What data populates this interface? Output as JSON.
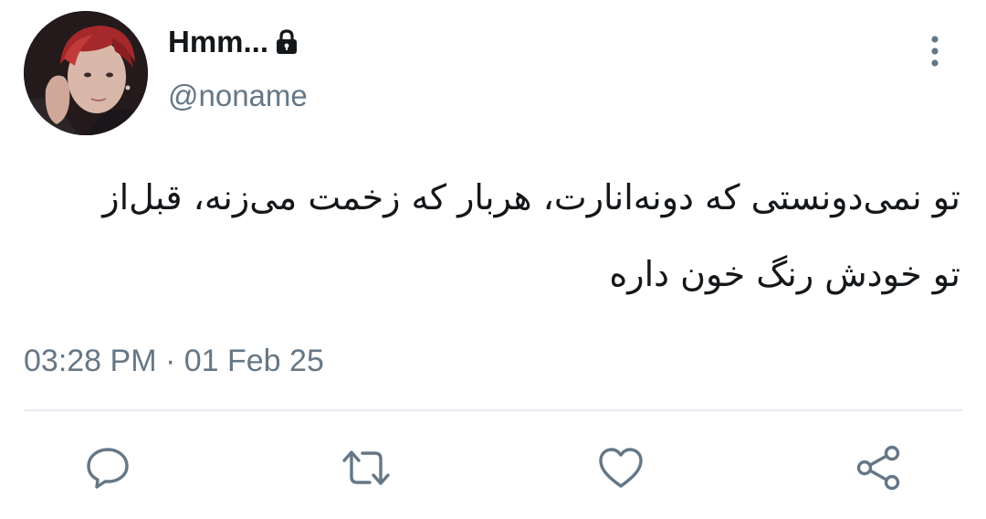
{
  "user": {
    "display_name": "Hmm...",
    "handle": "@noname",
    "protected_icon": "lock-icon",
    "avatar_icon": "profile-avatar"
  },
  "tweet": {
    "lines": [
      "تو نمی‌دونستی که دونه‌انارت، هربار که زخمت می‌زنه، قبل‌از",
      "تو خودش رنگ خون داره"
    ],
    "timestamp": "03:28 PM · 01 Feb 25"
  },
  "actions": {
    "reply_icon": "reply-icon",
    "retweet_icon": "retweet-icon",
    "like_icon": "heart-icon",
    "share_icon": "share-icon",
    "more_icon": "more-vertical-icon"
  },
  "colors": {
    "text": "#14171a",
    "secondary": "#657786",
    "divider": "#e6ecf0",
    "icon": "#657786"
  }
}
